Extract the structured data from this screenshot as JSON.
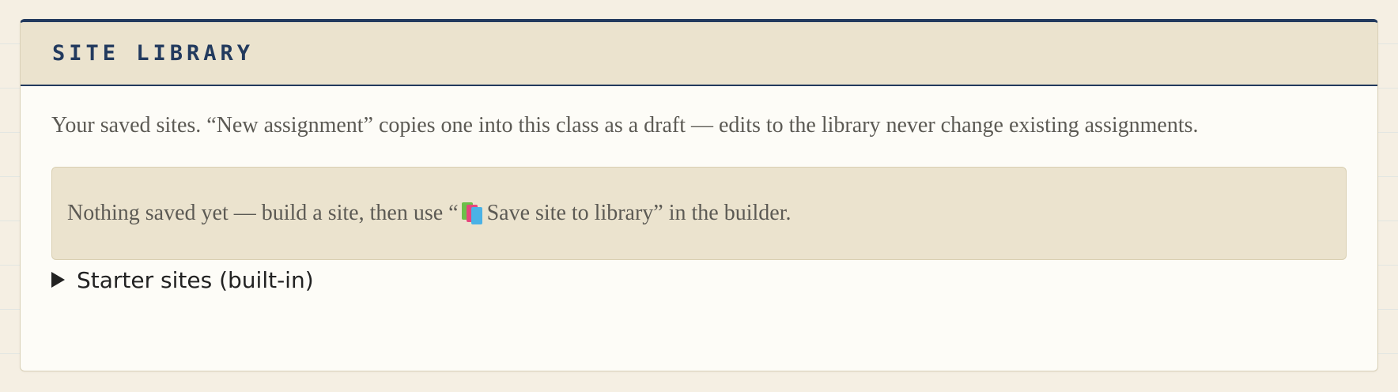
{
  "panel": {
    "title": "SITE LIBRARY",
    "intro": "Your saved sites. “New assignment” copies one into this class as a draft — edits to the library never change existing assignments.",
    "empty_state": {
      "text_before": "Nothing saved yet — build a site, then use “",
      "icon": "books-icon",
      "text_after": " Save site to library” in the builder."
    },
    "starter_sites": {
      "label": "Starter sites (built-in)",
      "expanded": false
    }
  },
  "colors": {
    "accent": "#223a5e",
    "header_bg": "#ebe3ce",
    "panel_bg": "#fdfcf7",
    "page_bg": "#f5efe3",
    "body_text": "#5c5a54"
  }
}
